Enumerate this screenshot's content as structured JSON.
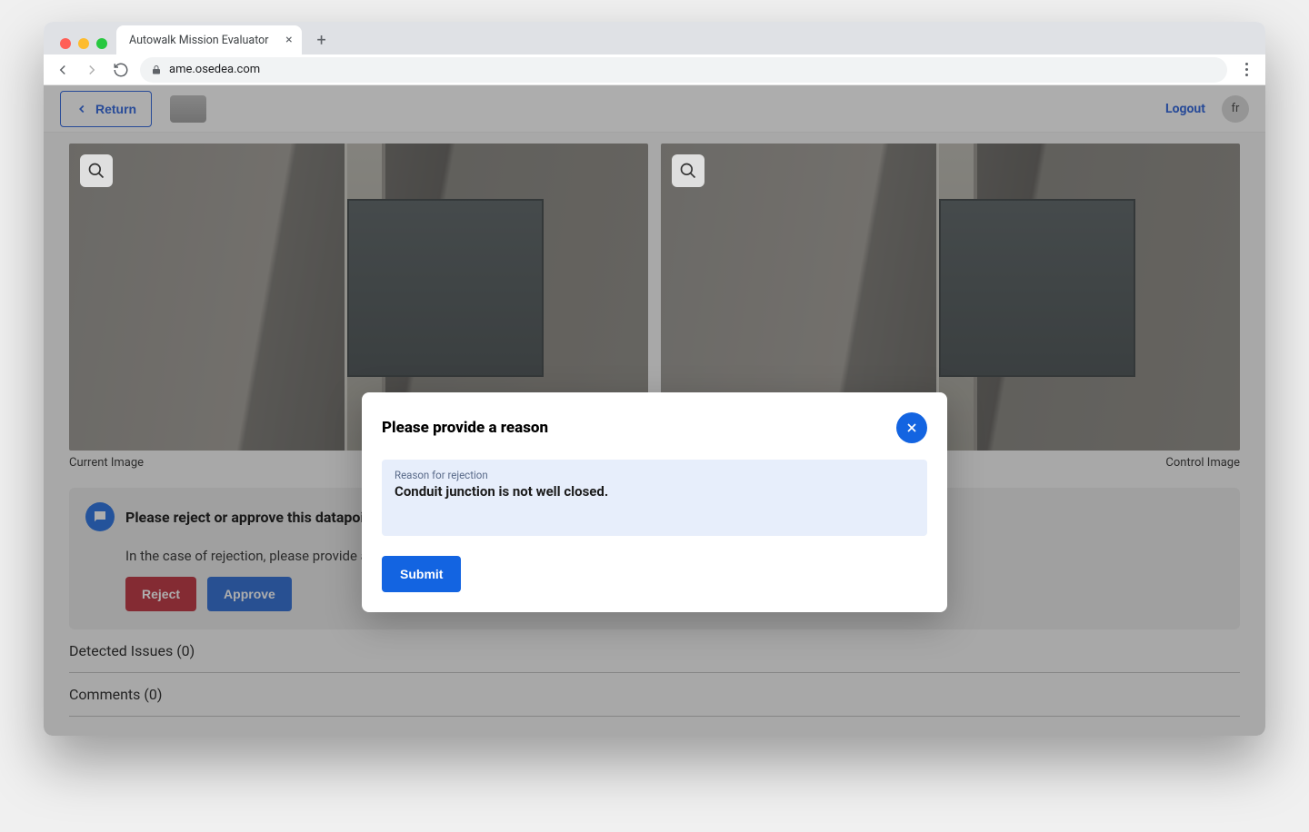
{
  "browser": {
    "tab_title": "Autowalk Mission Evaluator",
    "url": "ame.osedea.com"
  },
  "header": {
    "return_label": "Return",
    "logout_label": "Logout",
    "lang_code": "fr"
  },
  "images": {
    "left_caption": "Current Image",
    "right_caption": "Control Image"
  },
  "prompt": {
    "title": "Please reject or approve this datapoint:",
    "subtitle": "In the case of rejection, please provide a reason",
    "reject_label": "Reject",
    "approve_label": "Approve"
  },
  "sections": {
    "detected_issues_label": "Detected Issues (0)",
    "comments_label": "Comments (0)"
  },
  "modal": {
    "title": "Please provide a reason",
    "field_label": "Reason for rejection",
    "field_value": "Conduit junction is not well closed.",
    "submit_label": "Submit"
  }
}
